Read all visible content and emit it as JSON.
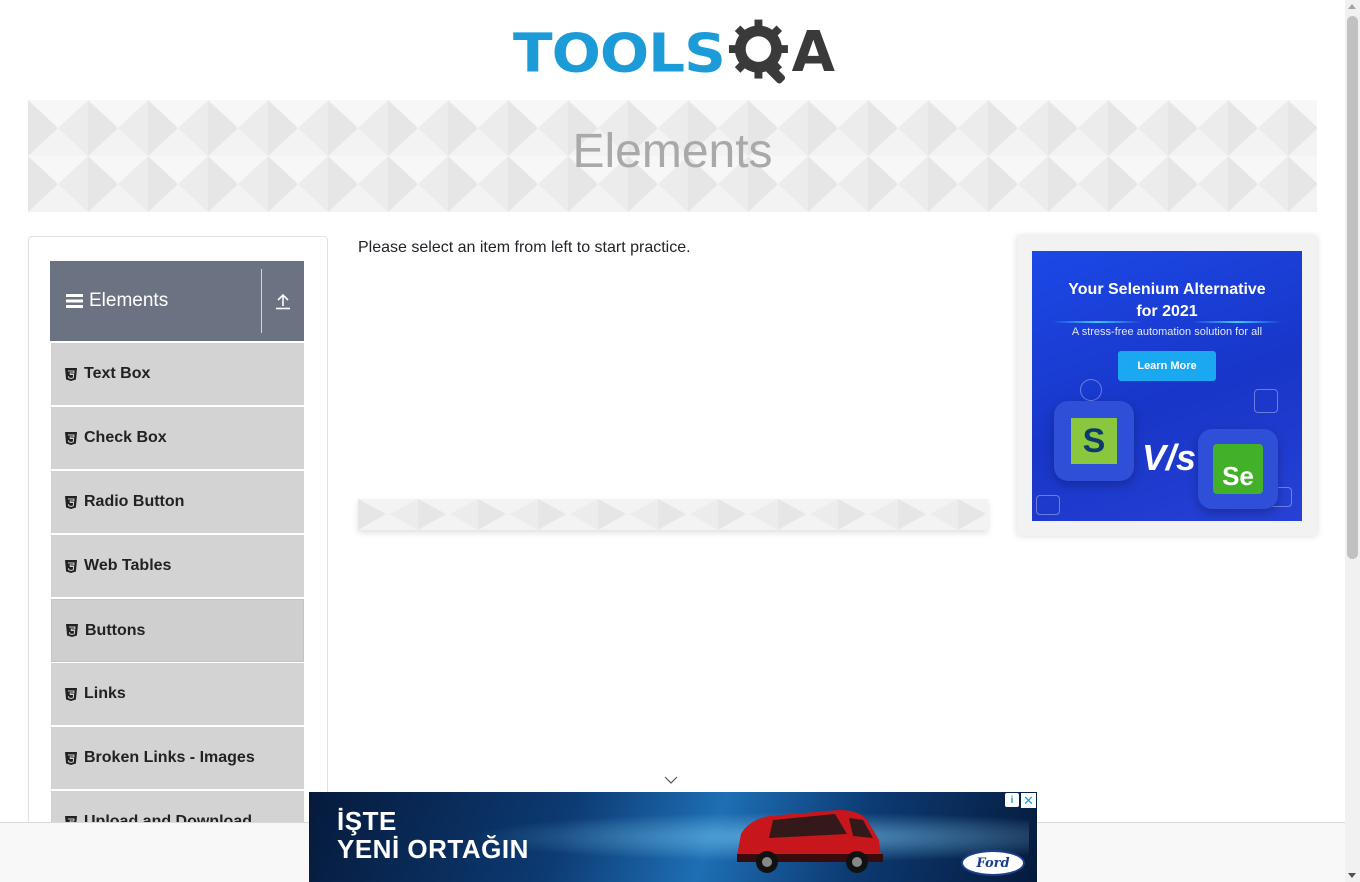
{
  "header": {
    "logo_text_tools": "TOOLS",
    "logo_text_a": "A",
    "logo_brand_color": "#1b9bd8",
    "logo_dark_color": "#3a3a3a"
  },
  "banner": {
    "title": "Elements"
  },
  "sidebar": {
    "group_title": "Elements",
    "group_bg_color": "#6b7281",
    "items": [
      {
        "label": "Text Box"
      },
      {
        "label": "Check Box"
      },
      {
        "label": "Radio Button"
      },
      {
        "label": "Web Tables"
      },
      {
        "label": "Buttons"
      },
      {
        "label": "Links"
      },
      {
        "label": "Broken Links - Images"
      },
      {
        "label": "Upload and Download"
      }
    ]
  },
  "main": {
    "message": "Please select an item from left to start practice."
  },
  "right_ad": {
    "headline_line1": "Your Selenium Alternative",
    "headline_line2": "for 2021",
    "subline": "A stress-free automation solution for all",
    "cta_label": "Learn More",
    "vs_text": "V/s",
    "tile_left_letter": "S",
    "tile_right_letter": "Se"
  },
  "bottom_ad": {
    "line1": "İŞTE",
    "line2": "YENİ ORTAĞIN",
    "brand": "Ford",
    "adchoices_symbol": "i",
    "close_symbol": "✕"
  }
}
